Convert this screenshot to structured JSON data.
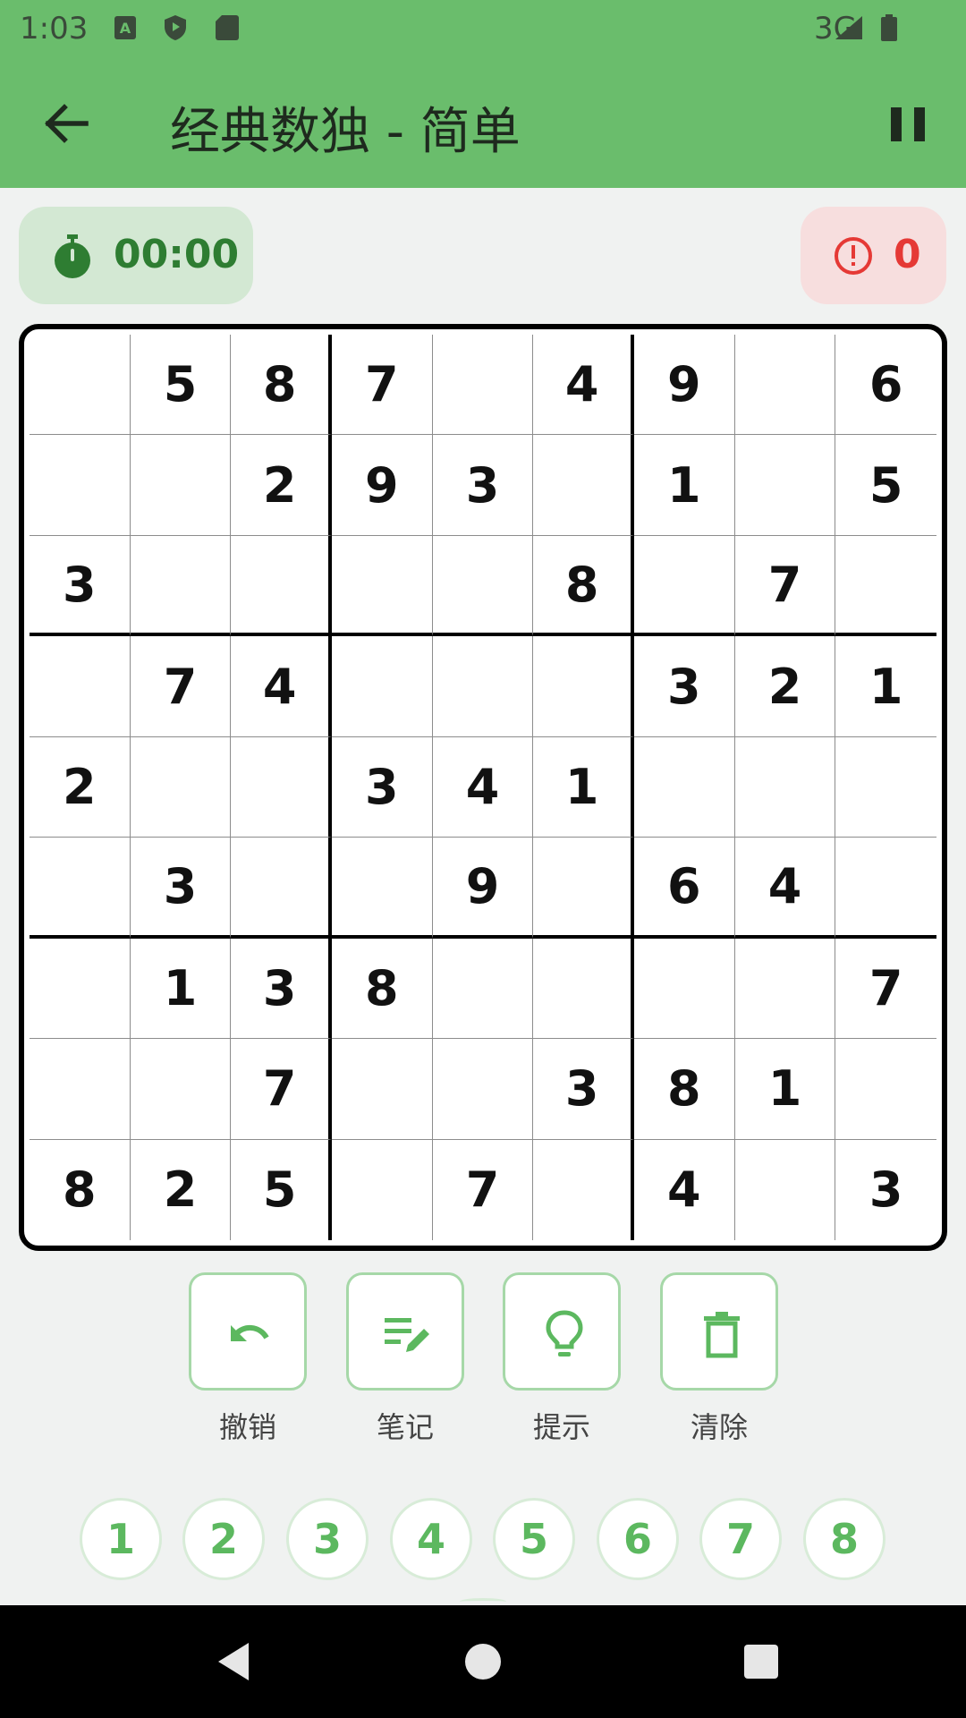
{
  "status_bar": {
    "time": "1:03",
    "network": "3G",
    "icons": [
      "a-icon",
      "shield-icon",
      "sd-card-icon",
      "signal-icon",
      "battery-icon"
    ]
  },
  "app_bar": {
    "title": "经典数独 - 简单",
    "back_icon": "arrow-left-icon",
    "pause_icon": "pause-icon"
  },
  "timer": {
    "value": "00:00",
    "icon": "stopwatch-icon"
  },
  "errors": {
    "value": "0",
    "icon": "alert-circle-icon"
  },
  "board": [
    [
      "",
      "5",
      "8",
      "7",
      "",
      "4",
      "9",
      "",
      "6"
    ],
    [
      "",
      "",
      "2",
      "9",
      "3",
      "",
      "1",
      "",
      "5"
    ],
    [
      "3",
      "",
      "",
      "",
      "",
      "8",
      "",
      "7",
      ""
    ],
    [
      "",
      "7",
      "4",
      "",
      "",
      "",
      "3",
      "2",
      "1"
    ],
    [
      "2",
      "",
      "",
      "3",
      "4",
      "1",
      "",
      "",
      ""
    ],
    [
      "",
      "3",
      "",
      "",
      "9",
      "",
      "6",
      "4",
      ""
    ],
    [
      "",
      "1",
      "3",
      "8",
      "",
      "",
      "",
      "",
      "7"
    ],
    [
      "",
      "",
      "7",
      "",
      "",
      "3",
      "8",
      "1",
      ""
    ],
    [
      "8",
      "2",
      "5",
      "",
      "7",
      "",
      "4",
      "",
      "3"
    ]
  ],
  "tools": [
    {
      "label": "撤销",
      "icon": "undo-icon"
    },
    {
      "label": "笔记",
      "icon": "edit-note-icon"
    },
    {
      "label": "提示",
      "icon": "lightbulb-icon"
    },
    {
      "label": "清除",
      "icon": "trash-icon"
    }
  ],
  "numbers": [
    "1",
    "2",
    "3",
    "4",
    "5",
    "6",
    "7",
    "8"
  ],
  "colors": {
    "app_bar": "#6abd6c",
    "accent": "#5cb85f",
    "timer_text": "#2e7d32",
    "error_text": "#e53935"
  }
}
